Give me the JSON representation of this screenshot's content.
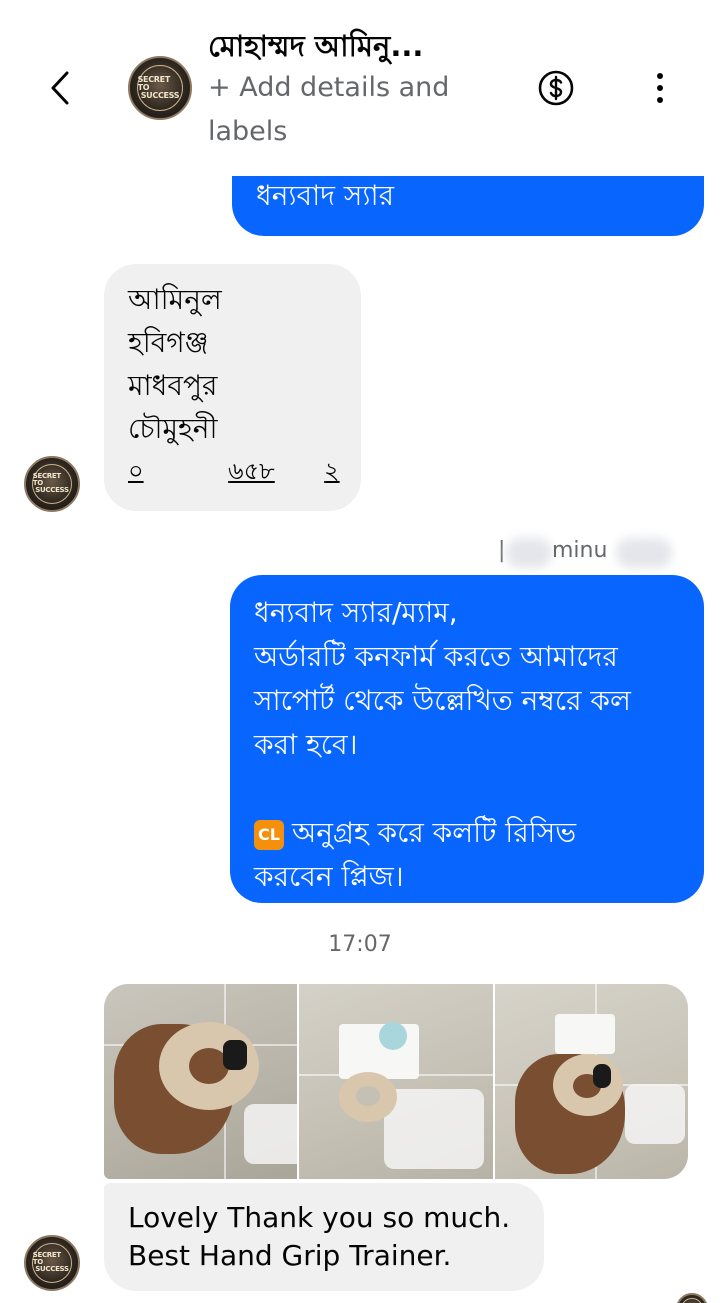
{
  "header": {
    "contact_name": "মোহাম্মদ আমিনু...",
    "add_details": "+ Add details and labels",
    "avatar_text_top": "SECRET TO",
    "avatar_text_bottom": "SUCCESS"
  },
  "messages": {
    "msg1": "ধন্যবাদ স্যার",
    "msg2_lines": [
      "আমিনুল",
      "হবিগঞ্জ",
      "মাধবপুর",
      "চৌমুহনী"
    ],
    "msg2_phone_start": "০",
    "msg2_phone_mid": "৬৫৮",
    "msg2_phone_end": "২",
    "seen_text": "minu",
    "msg3_lines": [
      "ধন্যবাদ স্যার/ম্যাম,",
      "অর্ডারটি কনফার্ম করতে আমাদের",
      "সাপোর্ট থেকে উল্লেখিত নম্বরে কল",
      "করা হবে।"
    ],
    "msg3_badge": "CL",
    "msg3_tail_lines": [
      "অনুগ্রহ করে কলটি রিসিভ",
      "করবেন প্লিজ।"
    ],
    "timestamp": "17:07",
    "msg4_lines": [
      "Lovely Thank you so much.",
      "Best Hand Grip Trainer."
    ]
  },
  "colors": {
    "outgoing_bubble": "#0866ff",
    "incoming_bubble": "#f0f0f0",
    "secondary_text": "#65676b"
  },
  "icons": {
    "back": "chevron-left-icon",
    "dollar": "dollar-circle-icon",
    "more": "more-vertical-icon"
  }
}
